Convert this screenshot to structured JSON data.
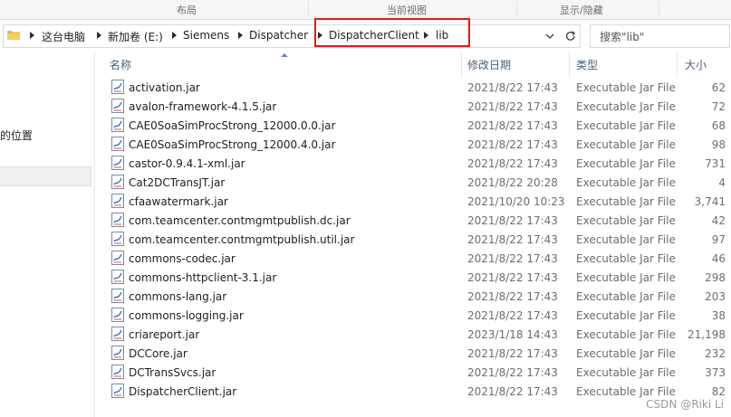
{
  "ribbon": {
    "groups": [
      "布局",
      "当前视图",
      "显示/隐藏"
    ]
  },
  "address": {
    "crumbs": [
      "这台电脑",
      "新加卷 (E:)",
      "Siemens",
      "Dispatcher",
      "DispatcherClient",
      "lib"
    ],
    "search_placeholder": "搜索\"lib\""
  },
  "nav": {
    "partial_text": "的位置"
  },
  "columns": {
    "name": "名称",
    "modified": "修改日期",
    "type": "类型",
    "size": "大小"
  },
  "files": [
    {
      "name": "activation.jar",
      "date": "2021/8/22 17:43",
      "type": "Executable Jar File",
      "size": "62"
    },
    {
      "name": "avalon-framework-4.1.5.jar",
      "date": "2021/8/22 17:43",
      "type": "Executable Jar File",
      "size": "72"
    },
    {
      "name": "CAE0SoaSimProcStrong_12000.0.0.jar",
      "date": "2021/8/22 17:43",
      "type": "Executable Jar File",
      "size": "68"
    },
    {
      "name": "CAE0SoaSimProcStrong_12000.4.0.jar",
      "date": "2021/8/22 17:43",
      "type": "Executable Jar File",
      "size": "98"
    },
    {
      "name": "castor-0.9.4.1-xml.jar",
      "date": "2021/8/22 17:43",
      "type": "Executable Jar File",
      "size": "731"
    },
    {
      "name": "Cat2DCTransJT.jar",
      "date": "2021/8/22 20:28",
      "type": "Executable Jar File",
      "size": "4"
    },
    {
      "name": "cfaawatermark.jar",
      "date": "2021/10/20 10:23",
      "type": "Executable Jar File",
      "size": "3,741"
    },
    {
      "name": "com.teamcenter.contmgmtpublish.dc.jar",
      "date": "2021/8/22 17:43",
      "type": "Executable Jar File",
      "size": "42"
    },
    {
      "name": "com.teamcenter.contmgmtpublish.util.jar",
      "date": "2021/8/22 17:43",
      "type": "Executable Jar File",
      "size": "97"
    },
    {
      "name": "commons-codec.jar",
      "date": "2021/8/22 17:43",
      "type": "Executable Jar File",
      "size": "46"
    },
    {
      "name": "commons-httpclient-3.1.jar",
      "date": "2021/8/22 17:43",
      "type": "Executable Jar File",
      "size": "298"
    },
    {
      "name": "commons-lang.jar",
      "date": "2021/8/22 17:43",
      "type": "Executable Jar File",
      "size": "203"
    },
    {
      "name": "commons-logging.jar",
      "date": "2021/8/22 17:43",
      "type": "Executable Jar File",
      "size": "38"
    },
    {
      "name": "criareport.jar",
      "date": "2023/1/18 14:43",
      "type": "Executable Jar File",
      "size": "21,198"
    },
    {
      "name": "DCCore.jar",
      "date": "2021/8/22 17:43",
      "type": "Executable Jar File",
      "size": "232"
    },
    {
      "name": "DCTransSvcs.jar",
      "date": "2021/8/22 17:43",
      "type": "Executable Jar File",
      "size": "373"
    },
    {
      "name": "DispatcherClient.jar",
      "date": "2021/8/22 17:43",
      "type": "Executable Jar File",
      "size": "82"
    }
  ],
  "watermark": "CSDN @Riki Li",
  "colors": {
    "highlight_border": "#e8161a",
    "header_text": "#4c607a"
  }
}
